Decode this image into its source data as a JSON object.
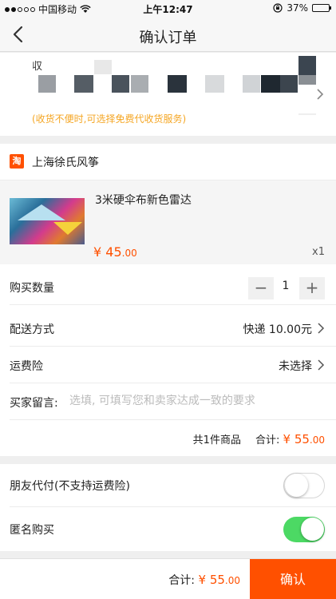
{
  "status_bar": {
    "carrier": "中国移动",
    "time": "上午12:47",
    "battery": "37%",
    "battery_level": 0.37
  },
  "nav": {
    "title": "确认订单"
  },
  "address": {
    "name_partial": "収",
    "note": "(收货不便时,可选择免费代收货服务)"
  },
  "store": {
    "icon_text": "淘",
    "name": "上海徐氏风筝"
  },
  "product": {
    "title": "3米硬伞布新色雷达",
    "currency": "¥",
    "price_int": "45",
    "price_dec": ".00",
    "quantity": "x1"
  },
  "order": {
    "qty_label": "购买数量",
    "qty_value": "1",
    "minus": "−",
    "plus": "+",
    "delivery_label": "配送方式",
    "delivery_value": "快递 10.00元",
    "insurance_label": "运费险",
    "insurance_value": "未选择",
    "message_label": "买家留言:",
    "message_placeholder": "选填, 可填写您和卖家达成一致的要求",
    "summary_count": "共1件商品",
    "summary_label": "合计:",
    "summary_currency": "¥",
    "summary_int": "55",
    "summary_dec": ".00"
  },
  "options": {
    "friend_pay_label": "朋友代付(不支持运费险)",
    "friend_pay_on": false,
    "anonymous_label": "匿名购买",
    "anonymous_on": true
  },
  "footer": {
    "total_label": "合计:",
    "currency": "¥",
    "total_int": "55",
    "total_dec": ".00",
    "confirm_label": "确认"
  },
  "colors": {
    "accent": "#ff5000",
    "toggle_on": "#4cd964",
    "note": "#f5a623"
  }
}
